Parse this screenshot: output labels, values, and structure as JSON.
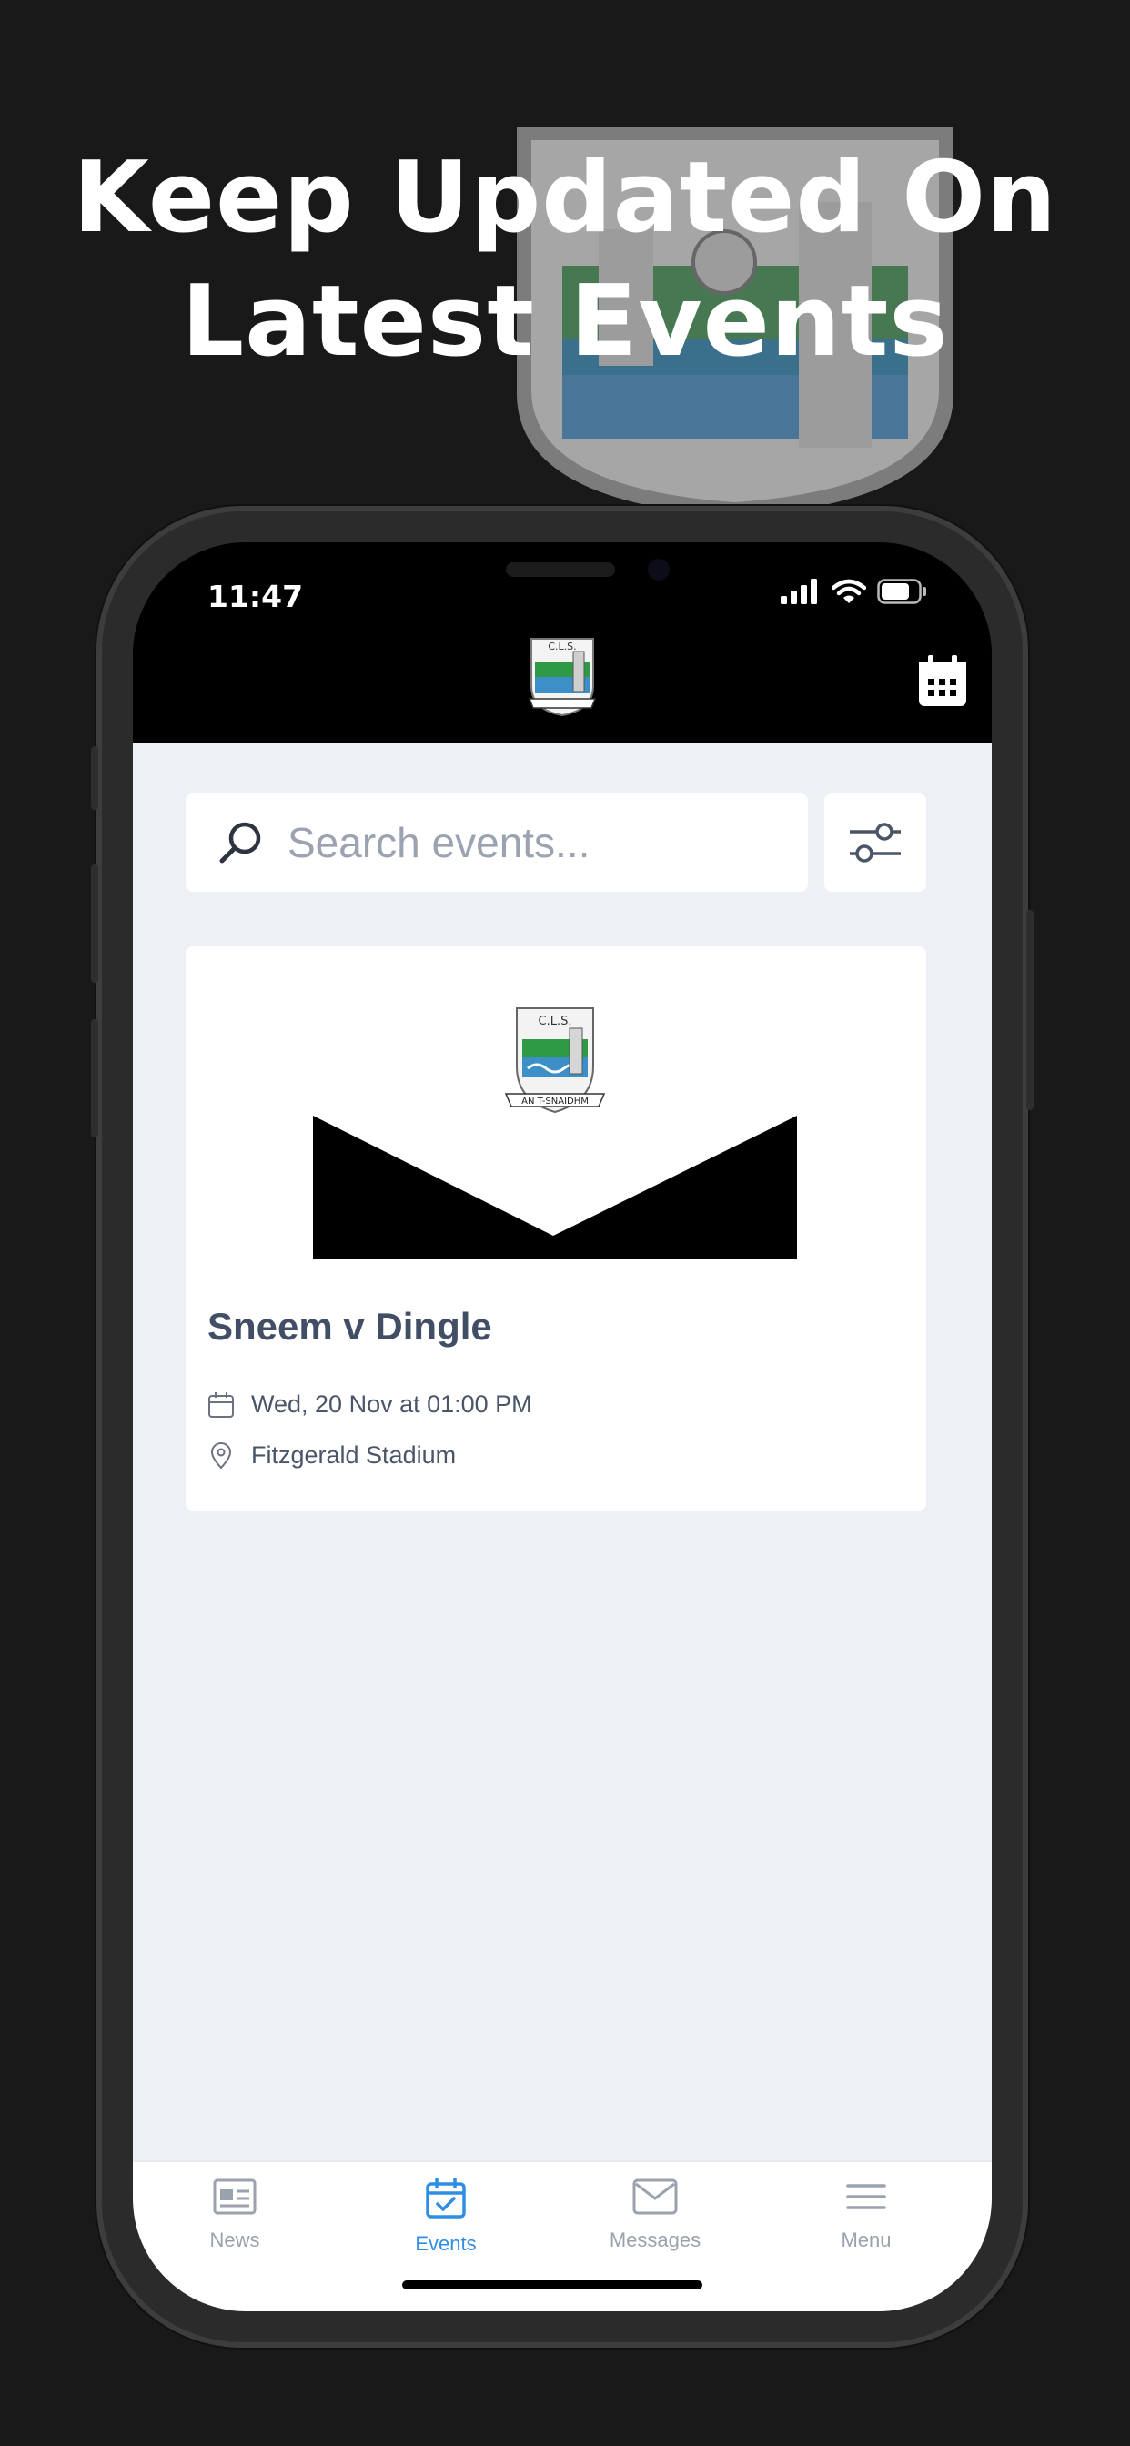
{
  "headline": {
    "line1": "Keep Updated On",
    "line2": "Latest Events"
  },
  "status_bar": {
    "time": "11:47",
    "icons": [
      "signal-icon",
      "wifi-icon",
      "battery-icon"
    ]
  },
  "header": {
    "logo_text": "C.L.S.",
    "calendar_icon": "calendar-icon"
  },
  "search": {
    "placeholder": "Search events...",
    "value": ""
  },
  "events": [
    {
      "title": "Sneem v Dingle",
      "date": "Wed, 20 Nov at 01:00 PM",
      "venue": "Fitzgerald Stadium",
      "crest_text": "C.L.S.",
      "crest_banner": "AN T-SNAIDHM"
    }
  ],
  "tabs": [
    {
      "label": "News",
      "icon": "news-icon",
      "active": false
    },
    {
      "label": "Events",
      "icon": "events-icon",
      "active": true
    },
    {
      "label": "Messages",
      "icon": "messages-icon",
      "active": false
    },
    {
      "label": "Menu",
      "icon": "menu-icon",
      "active": false
    }
  ],
  "colors": {
    "background": "#191919",
    "content_bg": "#edf0f5",
    "active_tab": "#2f8de4",
    "inactive_tab": "#9aa2ae",
    "title_text": "#424e65",
    "crest_green": "#2e9a46",
    "crest_blue": "#3d8fc7"
  }
}
